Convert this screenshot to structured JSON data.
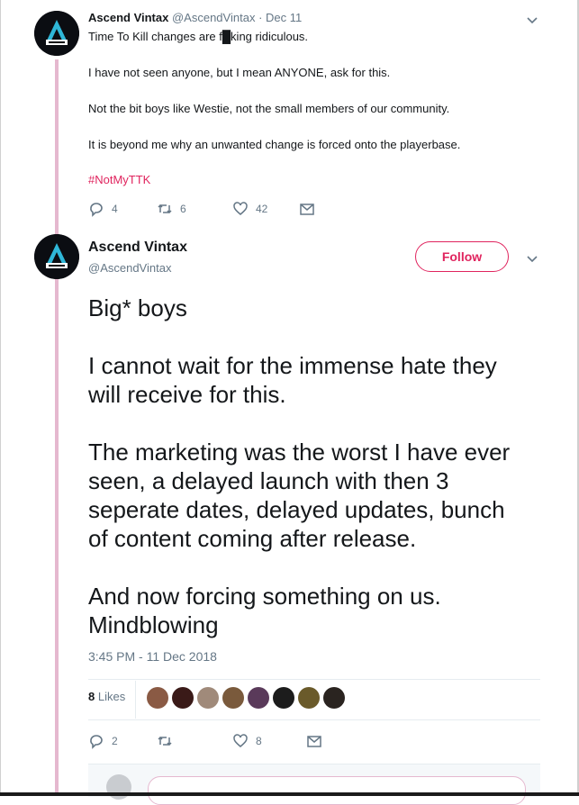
{
  "tweet1": {
    "name": "Ascend Vintax",
    "handle": "@AscendVintax",
    "date": "· Dec 11",
    "lines": [
      "Time To Kill changes are f█king ridiculous.",
      "I have not seen anyone, but I mean ANYONE, ask for this.",
      "Not the bit boys like Westie, not the small members of our community.",
      "It is beyond me why an unwanted change is forced onto the playerbase."
    ],
    "hashtag": "#NotMyTTK",
    "replies": "4",
    "retweets": "6",
    "likes": "42"
  },
  "tweet2": {
    "name": "Ascend Vintax",
    "handle": "@AscendVintax",
    "follow_label": "Follow",
    "lines": [
      "Big* boys",
      "I cannot wait for the immense hate they",
      "will receive for this.",
      "The marketing was the worst I have ever",
      "seen, a delayed launch with then 3",
      "seperate dates, delayed updates, bunch",
      "of content coming after release.",
      "And now forcing something on us.",
      "Mindblowing"
    ],
    "timestamp": "3:45 PM - 11 Dec 2018",
    "likes_count": "8",
    "likes_label": "Likes",
    "replies": "2",
    "retweets": "",
    "favs": "8"
  },
  "colors": {
    "accent": "#e0245e",
    "thread_line": "#e5b8cf",
    "muted": "#657786"
  },
  "icons": [
    "chevron-down-icon",
    "reply-icon",
    "retweet-icon",
    "heart-icon",
    "envelope-icon",
    "ascend-logo-icon"
  ]
}
